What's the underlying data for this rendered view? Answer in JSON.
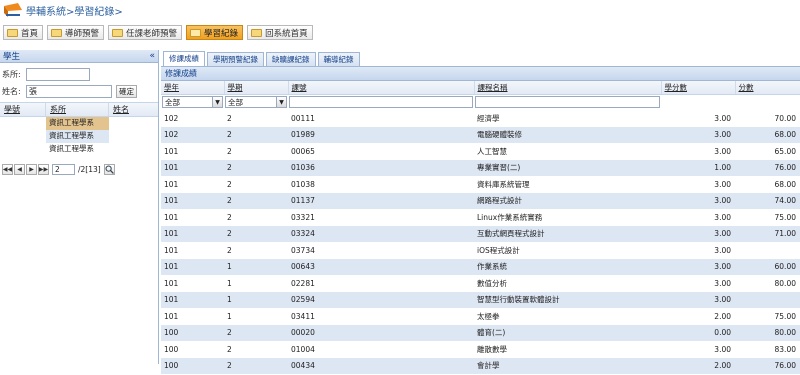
{
  "header": {
    "breadcrumb": "學輔系統>學習紀錄>"
  },
  "nav": [
    {
      "label": "首頁",
      "active": false
    },
    {
      "label": "導師預警",
      "active": false
    },
    {
      "label": "任課老師預警",
      "active": false
    },
    {
      "label": "學習紀錄",
      "active": true
    },
    {
      "label": "回系統首頁",
      "active": false
    }
  ],
  "student_panel": {
    "title": "學生",
    "collapse_glyph": "«",
    "dept_label": "系所:",
    "dept_value": "",
    "name_label": "姓名:",
    "name_value": "張",
    "confirm_label": "確定",
    "columns": [
      "學號",
      "系所",
      "姓名"
    ],
    "rows": [
      "資訊工程學系",
      "資訊工程學系",
      "資訊工程學系"
    ],
    "pager": {
      "page": "2",
      "total": "/2[13]"
    }
  },
  "tabs": [
    "修課成績",
    "學期預警紀錄",
    "缺曠課紀錄",
    "輔導紀錄"
  ],
  "grid": {
    "title": "修課成績",
    "columns": [
      "學年",
      "學期",
      "課號",
      "課程名稱",
      "學分數",
      "分數"
    ],
    "filters": {
      "year": "全部",
      "term": "全部"
    },
    "rows": [
      [
        "102",
        "2",
        "00111",
        "經濟學",
        "3.00",
        "70.00"
      ],
      [
        "102",
        "2",
        "01989",
        "電腦硬體裝修",
        "3.00",
        "68.00"
      ],
      [
        "101",
        "2",
        "00065",
        "人工智慧",
        "3.00",
        "65.00"
      ],
      [
        "101",
        "2",
        "01036",
        "專業實習(二)",
        "1.00",
        "76.00"
      ],
      [
        "101",
        "2",
        "01038",
        "資料庫系統管理",
        "3.00",
        "68.00"
      ],
      [
        "101",
        "2",
        "01137",
        "網路程式設計",
        "3.00",
        "74.00"
      ],
      [
        "101",
        "2",
        "03321",
        "Linux作業系統實務",
        "3.00",
        "75.00"
      ],
      [
        "101",
        "2",
        "03324",
        "互動式網頁程式設計",
        "3.00",
        "71.00"
      ],
      [
        "101",
        "2",
        "03734",
        "iOS程式設計",
        "3.00",
        ""
      ],
      [
        "101",
        "1",
        "00643",
        "作業系統",
        "3.00",
        "60.00"
      ],
      [
        "101",
        "1",
        "02281",
        "數值分析",
        "3.00",
        "80.00"
      ],
      [
        "101",
        "1",
        "02594",
        "智慧型行動裝置軟體設計",
        "3.00",
        ""
      ],
      [
        "101",
        "1",
        "03411",
        "太極拳",
        "2.00",
        "75.00"
      ],
      [
        "100",
        "2",
        "00020",
        "體育(二)",
        "0.00",
        "80.00"
      ],
      [
        "100",
        "2",
        "01004",
        "離散數學",
        "3.00",
        "83.00"
      ],
      [
        "100",
        "2",
        "00434",
        "會計學",
        "2.00",
        "76.00"
      ]
    ]
  }
}
